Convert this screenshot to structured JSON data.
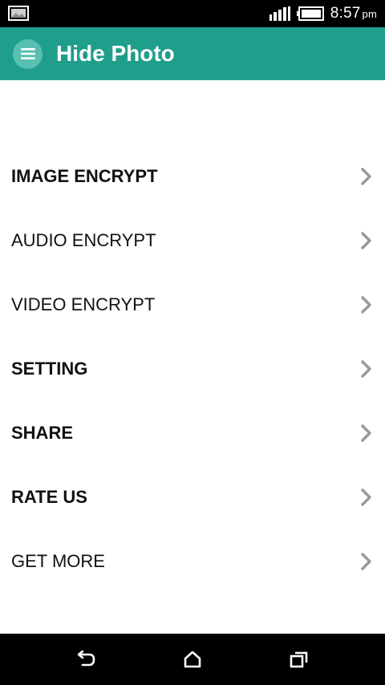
{
  "status_bar": {
    "time": "8:57",
    "ampm": "pm",
    "icons": [
      "gallery-icon",
      "signal-icon",
      "battery-icon"
    ]
  },
  "app_bar": {
    "title": "Hide Photo",
    "menu_icon": "hamburger-menu-icon",
    "color": "#1f9e8c"
  },
  "menu": {
    "items": [
      {
        "label": "IMAGE ENCRYPT"
      },
      {
        "label": "AUDIO ENCRYPT"
      },
      {
        "label": "VIDEO ENCRYPT"
      },
      {
        "label": "SETTING"
      },
      {
        "label": "SHARE"
      },
      {
        "label": "RATE US"
      },
      {
        "label": "GET MORE"
      }
    ],
    "chevron_icon": "chevron-right-icon"
  },
  "nav_bar": {
    "buttons": [
      "back-icon",
      "home-icon",
      "recents-icon"
    ]
  }
}
